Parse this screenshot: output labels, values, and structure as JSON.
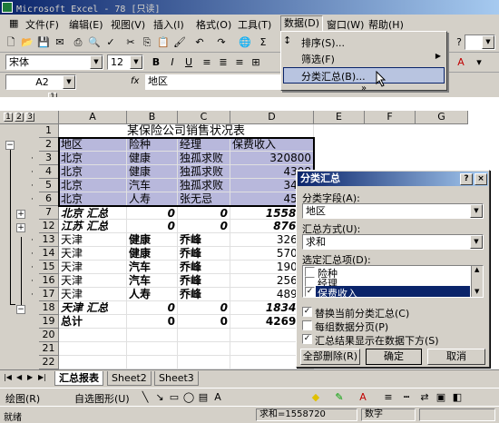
{
  "window": {
    "title": "Microsoft Excel - 78 [只读]"
  },
  "menu": [
    "文件(F)",
    "编辑(E)",
    "视图(V)",
    "插入(I)",
    "格式(O)",
    "工具(T)",
    "数据(D)",
    "窗口(W)",
    "帮助(H)"
  ],
  "toolbar": {
    "font_name": "宋体",
    "font_size": "12",
    "zoom": "?"
  },
  "formula_bar": {
    "name_box": "A2",
    "fx": "fx",
    "value": "地区"
  },
  "data_menu": {
    "items": [
      "排序(S)...",
      "筛选(F)",
      "分类汇总(B)..."
    ],
    "more": "»"
  },
  "outline": {
    "level_buttons": [
      "1",
      "2",
      "3"
    ],
    "col_level_buttons": [
      "1",
      "2"
    ]
  },
  "columns": [
    "A",
    "B",
    "C",
    "D",
    "E",
    "F",
    "G"
  ],
  "sheet": {
    "title": "某保险公司销售状况表",
    "header": [
      "地区",
      "险种",
      "经理",
      "保费收入"
    ],
    "rows": [
      {
        "row": "3",
        "cells": [
          "北京",
          "健康",
          "独孤求败",
          "320800"
        ]
      },
      {
        "row": "4",
        "cells": [
          "北京",
          "健康",
          "独孤求败",
          "4308"
        ]
      },
      {
        "row": "5",
        "cells": [
          "北京",
          "汽车",
          "独孤求败",
          "3498"
        ]
      },
      {
        "row": "6",
        "cells": [
          "北京",
          "人寿",
          "张无忌",
          "4572"
        ]
      },
      {
        "row": "7",
        "cells": [
          "北京 汇总",
          "0",
          "0",
          "155872"
        ]
      },
      {
        "row": "12",
        "cells": [
          "江苏 汇总",
          "0",
          "0",
          "87680"
        ]
      },
      {
        "row": "13",
        "cells": [
          "天津",
          "健康",
          "乔峰",
          "32689"
        ]
      },
      {
        "row": "14",
        "cells": [
          "天津",
          "健康",
          "乔峰",
          "57023"
        ]
      },
      {
        "row": "15",
        "cells": [
          "天津",
          "汽车",
          "乔峰",
          "19095"
        ]
      },
      {
        "row": "16",
        "cells": [
          "天津",
          "汽车",
          "乔峰",
          "25679"
        ]
      },
      {
        "row": "17",
        "cells": [
          "天津",
          "人寿",
          "乔峰",
          "48912"
        ]
      },
      {
        "row": "18",
        "cells": [
          "天津 汇总",
          "0",
          "0",
          "183401"
        ]
      },
      {
        "row": "19",
        "cells": [
          "总计",
          "0",
          "0",
          "426953"
        ]
      },
      {
        "row": "20",
        "cells": [
          "",
          "",
          "",
          ""
        ]
      },
      {
        "row": "21",
        "cells": [
          "",
          "",
          "",
          ""
        ]
      },
      {
        "row": "22",
        "cells": [
          "",
          "",
          "",
          ""
        ]
      }
    ],
    "row_labels_top": [
      "1",
      "2"
    ]
  },
  "dialog": {
    "title": "分类汇总",
    "help": "?",
    "close": "×",
    "group_label": "分类字段(A):",
    "group_value": "地区",
    "func_label": "汇总方式(U):",
    "func_value": "求和",
    "items_label": "选定汇总项(D):",
    "items": [
      {
        "label": "险种",
        "checked": false
      },
      {
        "label": "经理",
        "checked": false
      },
      {
        "label": "保费收入",
        "checked": true
      }
    ],
    "options": [
      {
        "label": "替换当前分类汇总(C)",
        "checked": true
      },
      {
        "label": "每组数据分页(P)",
        "checked": false
      },
      {
        "label": "汇总结果显示在数据下方(S)",
        "checked": true
      }
    ],
    "btn_remove": "全部删除(R)",
    "btn_ok": "确定",
    "btn_cancel": "取消"
  },
  "tabs": [
    "汇总报表",
    "Sheet2",
    "Sheet3"
  ],
  "drawing_bar": {
    "draw": "绘图(R)",
    "autoshape": "自选图形(U)"
  },
  "status": {
    "ready": "就绪",
    "sum": "求和=1558720",
    "mode": "数字"
  }
}
